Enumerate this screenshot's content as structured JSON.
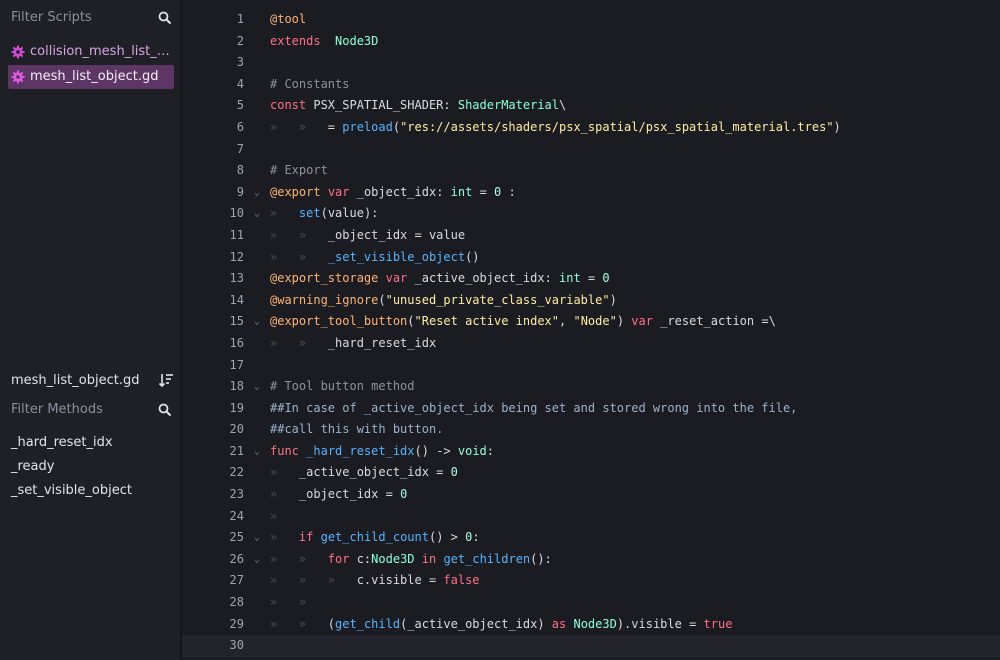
{
  "sidebar": {
    "filter_scripts_placeholder": "Filter Scripts",
    "scripts": [
      {
        "name": "collision_mesh_list_object.gd",
        "selected": false
      },
      {
        "name": "mesh_list_object.gd",
        "selected": true
      }
    ],
    "current_file": "mesh_list_object.gd",
    "filter_methods_placeholder": "Filter Methods",
    "methods": [
      "_hard_reset_idx",
      "_ready",
      "_set_visible_object"
    ]
  },
  "editor": {
    "current_line": 30,
    "lines": [
      {
        "n": "1",
        "fold": "",
        "segs": [
          [
            "ann",
            "@tool"
          ]
        ]
      },
      {
        "n": "2",
        "fold": "",
        "segs": [
          [
            "kw",
            "extends"
          ],
          [
            "",
            "  "
          ],
          [
            "type",
            "Node3D"
          ]
        ]
      },
      {
        "n": "3",
        "fold": "",
        "segs": []
      },
      {
        "n": "4",
        "fold": "",
        "segs": [
          [
            "cmt",
            "# Constants"
          ]
        ]
      },
      {
        "n": "5",
        "fold": "",
        "segs": [
          [
            "kw",
            "const"
          ],
          [
            "",
            " PSX_SPATIAL_SHADER: "
          ],
          [
            "type",
            "ShaderMaterial"
          ],
          [
            "",
            "\\"
          ]
        ]
      },
      {
        "n": "6",
        "fold": "",
        "segs": [
          [
            "tab",
            "»   »   "
          ],
          [
            "",
            ""
          ],
          [
            "",
            "= "
          ],
          [
            "fn",
            "preload"
          ],
          [
            "",
            "("
          ],
          [
            "str",
            "\"res://assets/shaders/psx_spatial/psx_spatial_material.tres\""
          ],
          [
            "",
            ")"
          ]
        ]
      },
      {
        "n": "7",
        "fold": "",
        "segs": []
      },
      {
        "n": "8",
        "fold": "",
        "segs": [
          [
            "cmt",
            "# Export"
          ]
        ]
      },
      {
        "n": "9",
        "fold": "⌄",
        "segs": [
          [
            "ann",
            "@export"
          ],
          [
            "",
            " "
          ],
          [
            "kw",
            "var"
          ],
          [
            "",
            " _object_idx: "
          ],
          [
            "type",
            "int"
          ],
          [
            "",
            " = "
          ],
          [
            "num",
            "0"
          ],
          [
            "",
            " :"
          ]
        ]
      },
      {
        "n": "10",
        "fold": "⌄",
        "segs": [
          [
            "tab",
            "»   "
          ],
          [
            "fn",
            "set"
          ],
          [
            "",
            "(value):"
          ]
        ]
      },
      {
        "n": "11",
        "fold": "",
        "segs": [
          [
            "tab",
            "»   »   "
          ],
          [
            "",
            "_object_idx = value"
          ]
        ]
      },
      {
        "n": "12",
        "fold": "",
        "segs": [
          [
            "tab",
            "»   »   "
          ],
          [
            "fn",
            "_set_visible_object"
          ],
          [
            "",
            "()"
          ]
        ]
      },
      {
        "n": "13",
        "fold": "",
        "segs": [
          [
            "ann",
            "@export_storage"
          ],
          [
            "",
            " "
          ],
          [
            "kw",
            "var"
          ],
          [
            "",
            " _active_object_idx: "
          ],
          [
            "type",
            "int"
          ],
          [
            "",
            " = "
          ],
          [
            "num",
            "0"
          ]
        ]
      },
      {
        "n": "14",
        "fold": "",
        "segs": [
          [
            "ann",
            "@warning_ignore"
          ],
          [
            "",
            "("
          ],
          [
            "str",
            "\"unused_private_class_variable\""
          ],
          [
            "",
            ")"
          ]
        ]
      },
      {
        "n": "15",
        "fold": "⌄",
        "segs": [
          [
            "ann",
            "@export_tool_button"
          ],
          [
            "",
            "("
          ],
          [
            "str",
            "\"Reset active index\""
          ],
          [
            "",
            ", "
          ],
          [
            "str",
            "\"Node\""
          ],
          [
            "",
            ") "
          ],
          [
            "kw",
            "var"
          ],
          [
            "",
            " _reset_action =\\"
          ]
        ]
      },
      {
        "n": "16",
        "fold": "",
        "segs": [
          [
            "tab",
            "»   »   "
          ],
          [
            "",
            "_hard_reset_idx"
          ]
        ]
      },
      {
        "n": "17",
        "fold": "",
        "segs": []
      },
      {
        "n": "18",
        "fold": "⌄",
        "segs": [
          [
            "cmt",
            "# Tool button method"
          ]
        ]
      },
      {
        "n": "19",
        "fold": "",
        "segs": [
          [
            "doc",
            "##In case of _active_object_idx being set and stored wrong into the file,"
          ]
        ]
      },
      {
        "n": "20",
        "fold": "",
        "segs": [
          [
            "doc",
            "##call this with button."
          ]
        ]
      },
      {
        "n": "21",
        "fold": "⌄",
        "segs": [
          [
            "kw",
            "func"
          ],
          [
            "",
            " "
          ],
          [
            "fn",
            "_hard_reset_idx"
          ],
          [
            "",
            "() -> "
          ],
          [
            "type",
            "void"
          ],
          [
            "",
            ":"
          ]
        ]
      },
      {
        "n": "22",
        "fold": "",
        "segs": [
          [
            "tab",
            "»   "
          ],
          [
            "",
            "_active_object_idx = "
          ],
          [
            "num",
            "0"
          ]
        ]
      },
      {
        "n": "23",
        "fold": "",
        "segs": [
          [
            "tab",
            "»   "
          ],
          [
            "",
            "_object_idx = "
          ],
          [
            "num",
            "0"
          ]
        ]
      },
      {
        "n": "24",
        "fold": "",
        "segs": [
          [
            "tab",
            "»"
          ]
        ]
      },
      {
        "n": "25",
        "fold": "⌄",
        "segs": [
          [
            "tab",
            "»   "
          ],
          [
            "kw",
            "if"
          ],
          [
            "",
            " "
          ],
          [
            "fn",
            "get_child_count"
          ],
          [
            "",
            "() > "
          ],
          [
            "num",
            "0"
          ],
          [
            "",
            ":"
          ]
        ]
      },
      {
        "n": "26",
        "fold": "⌄",
        "segs": [
          [
            "tab",
            "»   »   "
          ],
          [
            "kw",
            "for"
          ],
          [
            "",
            " c:"
          ],
          [
            "type",
            "Node3D"
          ],
          [
            "",
            " "
          ],
          [
            "kw",
            "in"
          ],
          [
            "",
            " "
          ],
          [
            "fn",
            "get_children"
          ],
          [
            "",
            "():"
          ]
        ]
      },
      {
        "n": "27",
        "fold": "",
        "segs": [
          [
            "tab",
            "»   »   »   "
          ],
          [
            "",
            "c.visible = "
          ],
          [
            "kw",
            "false"
          ]
        ]
      },
      {
        "n": "28",
        "fold": "",
        "segs": [
          [
            "tab",
            "»   »"
          ]
        ]
      },
      {
        "n": "29",
        "fold": "",
        "segs": [
          [
            "tab",
            "»   »   "
          ],
          [
            "",
            "("
          ],
          [
            "fn",
            "get_child"
          ],
          [
            "",
            "(_active_object_idx) "
          ],
          [
            "kw",
            "as"
          ],
          [
            "",
            " "
          ],
          [
            "type",
            "Node3D"
          ],
          [
            "",
            ").visible = "
          ],
          [
            "kw",
            "true"
          ]
        ]
      },
      {
        "n": "30",
        "fold": "",
        "segs": []
      }
    ]
  }
}
